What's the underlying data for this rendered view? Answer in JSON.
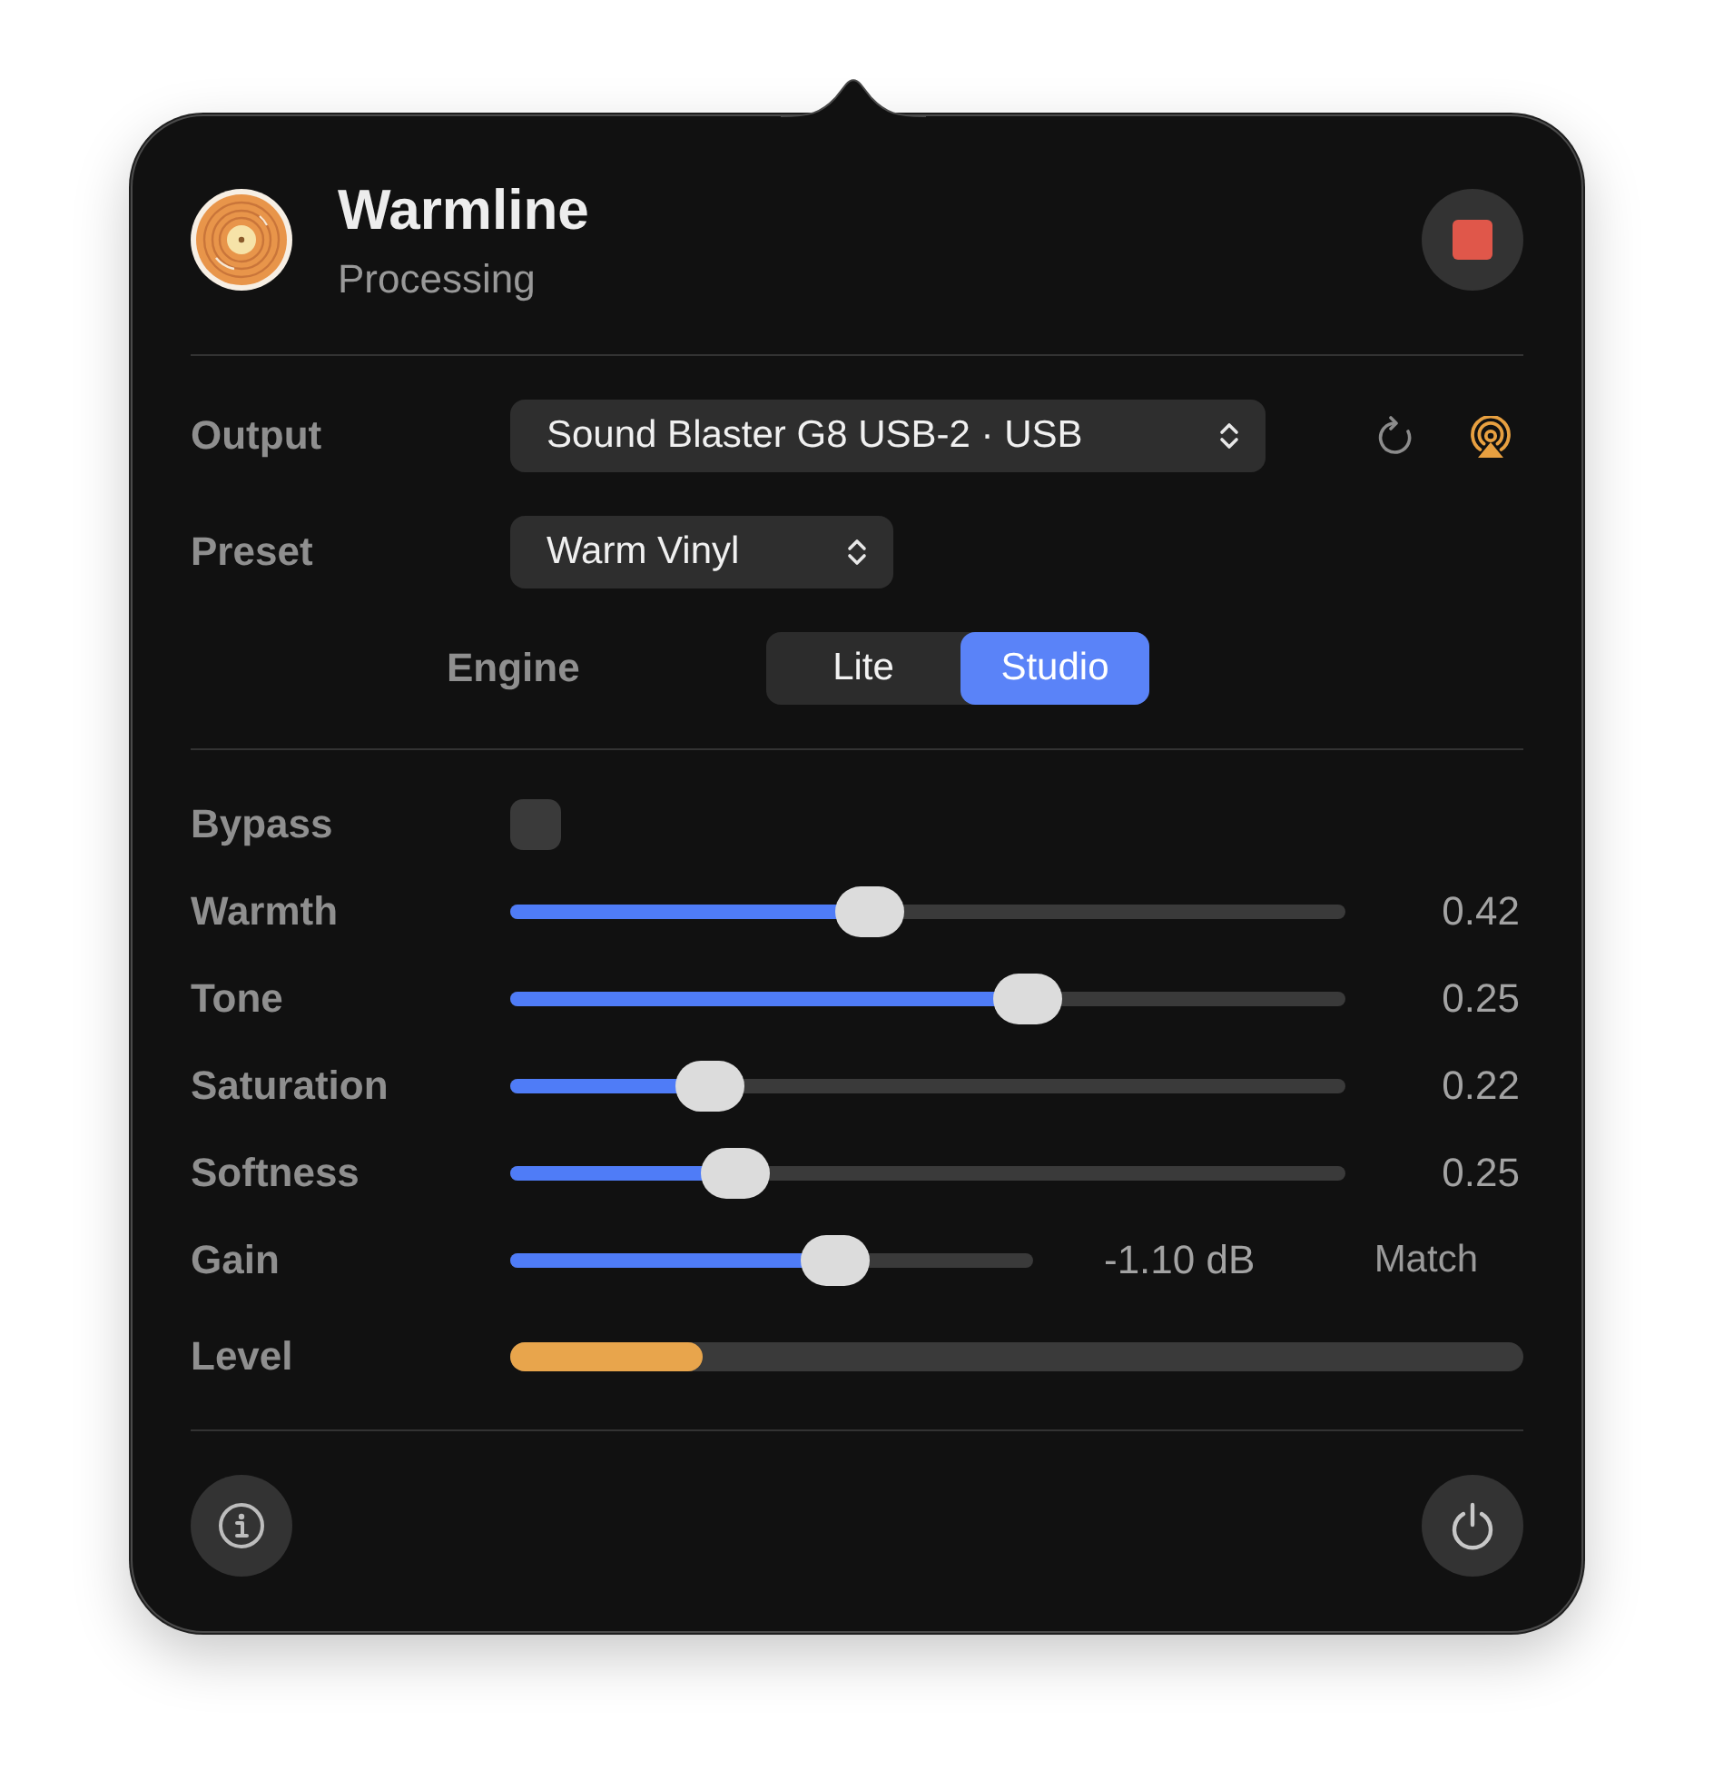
{
  "app": {
    "title": "Warmline",
    "status": "Processing"
  },
  "output": {
    "label": "Output",
    "value": "Sound Blaster G8 USB-2 · USB"
  },
  "preset": {
    "label": "Preset",
    "value": "Warm Vinyl"
  },
  "engine": {
    "label": "Engine",
    "options": [
      {
        "label": "Lite",
        "selected": false
      },
      {
        "label": "Studio",
        "selected": true
      }
    ]
  },
  "controls": [
    {
      "kind": "checkbox",
      "label": "Bypass",
      "checked": false
    },
    {
      "kind": "slider",
      "label": "Warmth",
      "level": 0.43,
      "reading": "0.42"
    },
    {
      "kind": "slider",
      "label": "Tone",
      "level": 0.62,
      "reading": "0.25"
    },
    {
      "kind": "slider",
      "label": "Saturation",
      "level": 0.24,
      "reading": "0.22"
    },
    {
      "kind": "slider",
      "label": "Softness",
      "level": 0.27,
      "reading": "0.25"
    },
    {
      "kind": "slider",
      "label": "Gain",
      "level": 0.62,
      "reading": "-1.10 dB",
      "action": "Match"
    },
    {
      "kind": "meter",
      "label": "Level",
      "level": 0.19
    }
  ]
}
